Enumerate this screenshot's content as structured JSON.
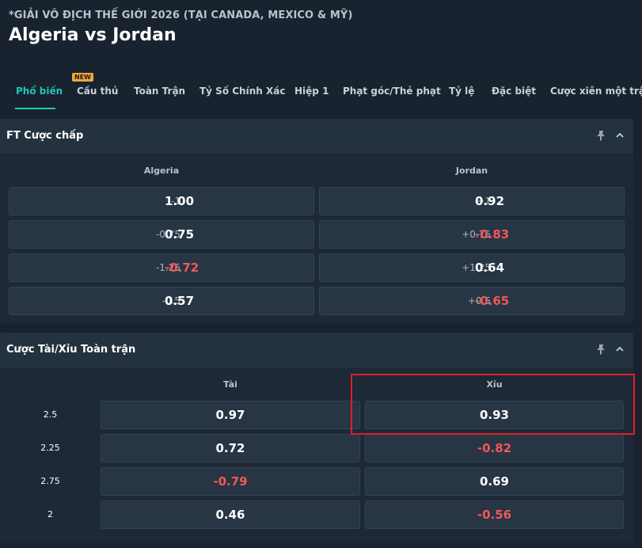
{
  "header": {
    "competition": "*GIẢI VÔ ĐỊCH THẾ GIỚI 2026 (TẠI CANADA, MEXICO & MỸ)",
    "match": "Algeria vs Jordan"
  },
  "tabs": [
    {
      "label": "Phổ biến",
      "active": true
    },
    {
      "label": "Cầu thủ",
      "badge": "NEW"
    },
    {
      "label": "Toàn Trận"
    },
    {
      "label": "Tỷ Số Chính Xác"
    },
    {
      "label": "Hiệp 1"
    },
    {
      "label": "Phạt góc/Thẻ phạt"
    },
    {
      "label": "Tỷ lệ"
    },
    {
      "label": "Đặc biệt"
    },
    {
      "label": "Cược xiên một trận"
    }
  ],
  "handicap": {
    "title": "FT Cược chấp",
    "home": "Algeria",
    "away": "Jordan",
    "rows": [
      {
        "home_line": "-1",
        "home_odds": "1.00",
        "away_line": "+1",
        "away_odds": "0.92"
      },
      {
        "home_line": "-0.75",
        "home_odds": "0.75",
        "away_line": "+0.75",
        "away_odds": "-0.83"
      },
      {
        "home_line": "-1.25",
        "home_odds": "-0.72",
        "away_line": "+1.25",
        "away_odds": "0.64"
      },
      {
        "home_line": "-0.5",
        "home_odds": "0.57",
        "away_line": "+0.5",
        "away_odds": "-0.65"
      }
    ]
  },
  "overunder": {
    "title": "Cược Tài/Xỉu Toàn trận",
    "over": "Tài",
    "under": "Xỉu",
    "rows": [
      {
        "line": "2.5",
        "over": "0.97",
        "under": "0.93"
      },
      {
        "line": "2.25",
        "over": "0.72",
        "under": "-0.82"
      },
      {
        "line": "2.75",
        "over": "-0.79",
        "under": "0.69"
      },
      {
        "line": "2",
        "over": "0.46",
        "under": "-0.56"
      }
    ]
  },
  "colors": {
    "accent": "#1fc7b4",
    "negative": "#f25757",
    "highlight": "#e01f25"
  }
}
